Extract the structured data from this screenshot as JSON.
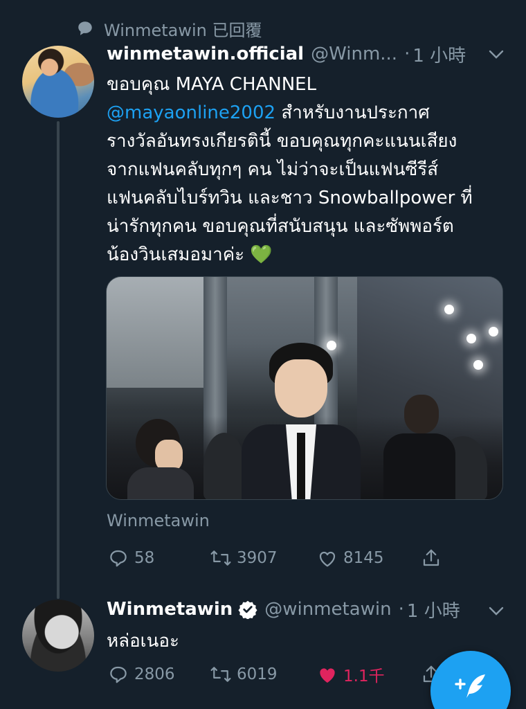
{
  "context": {
    "icon": "reply-bubble-icon",
    "text": "Winmetawin 已回覆"
  },
  "tweet1": {
    "display_name": "winmetawin.official",
    "handle": "@Winm...",
    "separator": "·",
    "time": "1 小時",
    "text_lines": [
      "ขอบคุณ MAYA CHANNEL",
      "สำหรับงานประกาศ",
      "รางวัลอันทรงเกียรตินี้ ขอบคุณทุกคะแนนเสียง",
      "จากแฟนคลับทุกๆ คน ไม่ว่าจะเป็นแฟนซีรีส์",
      "แฟนคลับไบร์ทวิน และชาว Snowballpower ที่",
      "น่ารักทุกคน ขอบคุณที่สนับสนุน และซัพพอร์ต",
      "น้องวินเสมอมาค่ะ 💚"
    ],
    "mention": "@mayaonline2002",
    "media_alt": "Photo of a man in a suit at an event",
    "source": "Winmetawin",
    "reply_count": "58",
    "retweet_count": "3907",
    "like_count": "8145"
  },
  "tweet2": {
    "display_name": "Winmetawin",
    "handle": "@winmetawin",
    "separator": "·",
    "time": "1 小時",
    "text": "หล่อเนอะ",
    "reply_count": "2806",
    "retweet_count": "6019",
    "like_count": "1.1千"
  },
  "colors": {
    "background": "#15202b",
    "muted": "#8899a6",
    "accent": "#1da1f2",
    "like": "#e0245e"
  },
  "fab": {
    "icon": "compose-feather-icon"
  }
}
